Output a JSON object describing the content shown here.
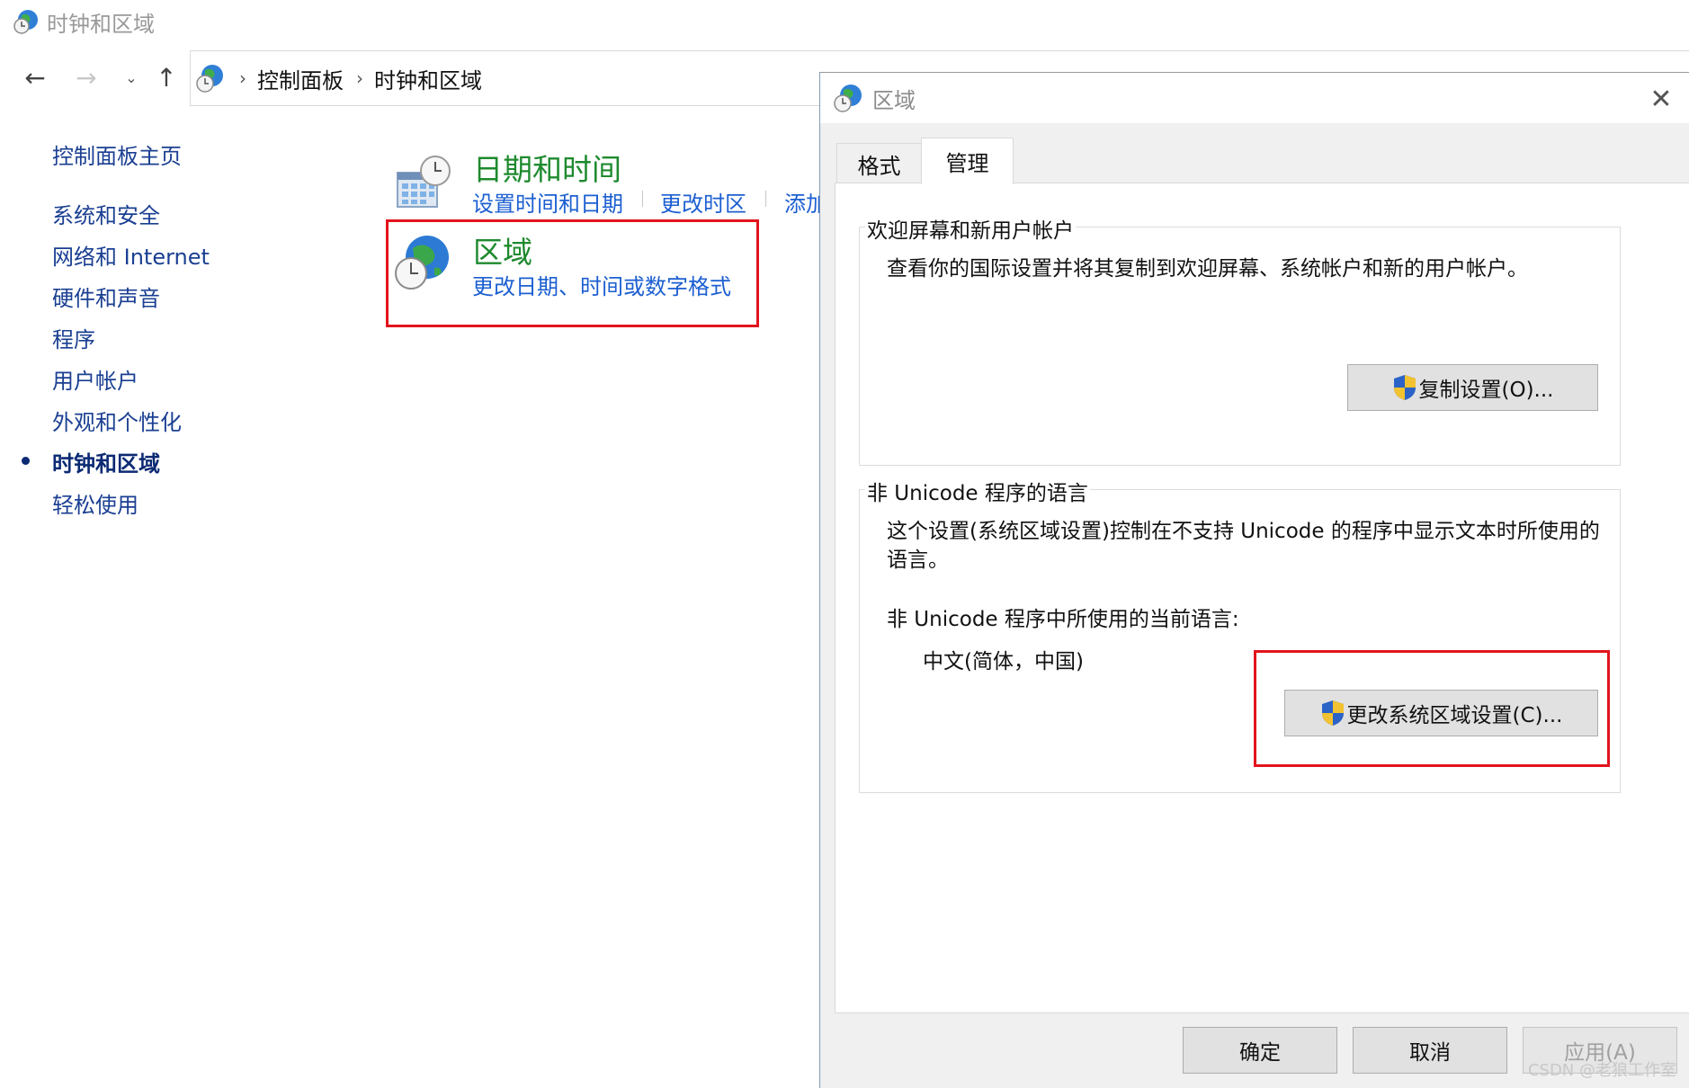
{
  "window": {
    "title": "时钟和区域"
  },
  "navigation": {
    "breadcrumb": [
      "控制面板",
      "时钟和区域"
    ]
  },
  "sidebar": {
    "items": [
      {
        "label": "控制面板主页",
        "active": false
      },
      {
        "label": "系统和安全",
        "active": false
      },
      {
        "label": "网络和 Internet",
        "active": false
      },
      {
        "label": "硬件和声音",
        "active": false
      },
      {
        "label": "程序",
        "active": false
      },
      {
        "label": "用户帐户",
        "active": false
      },
      {
        "label": "外观和个性化",
        "active": false
      },
      {
        "label": "时钟和区域",
        "active": true
      },
      {
        "label": "轻松使用",
        "active": false
      }
    ]
  },
  "categories": {
    "datetime": {
      "title": "日期和时间",
      "links": [
        "设置时间和日期",
        "更改时区",
        "添加"
      ]
    },
    "region": {
      "title": "区域",
      "links": [
        "更改日期、时间或数字格式"
      ]
    }
  },
  "dialog": {
    "title": "区域",
    "tabs": [
      {
        "label": "格式",
        "selected": false
      },
      {
        "label": "管理",
        "selected": true
      }
    ],
    "welcome_group": {
      "legend": "欢迎屏幕和新用户帐户",
      "description": "查看你的国际设置并将其复制到欢迎屏幕、系统帐户和新的用户帐户。",
      "copy_button": "复制设置(O)..."
    },
    "unicode_group": {
      "legend": "非 Unicode 程序的语言",
      "description": "这个设置(系统区域设置)控制在不支持 Unicode 的程序中显示文本时所使用的语言。",
      "current_label": "非 Unicode 程序中所使用的当前语言:",
      "current_value": "中文(简体，中国)",
      "change_button": "更改系统区域设置(C)..."
    },
    "buttons": {
      "ok": "确定",
      "cancel": "取消",
      "apply": "应用(A)"
    }
  },
  "watermark": "CSDN @老狼工作室",
  "colors": {
    "link_blue": "#1c5fd1",
    "category_green": "#1e8a2e",
    "highlight_red": "#e2141d",
    "nav_blue": "#1a3f92"
  }
}
